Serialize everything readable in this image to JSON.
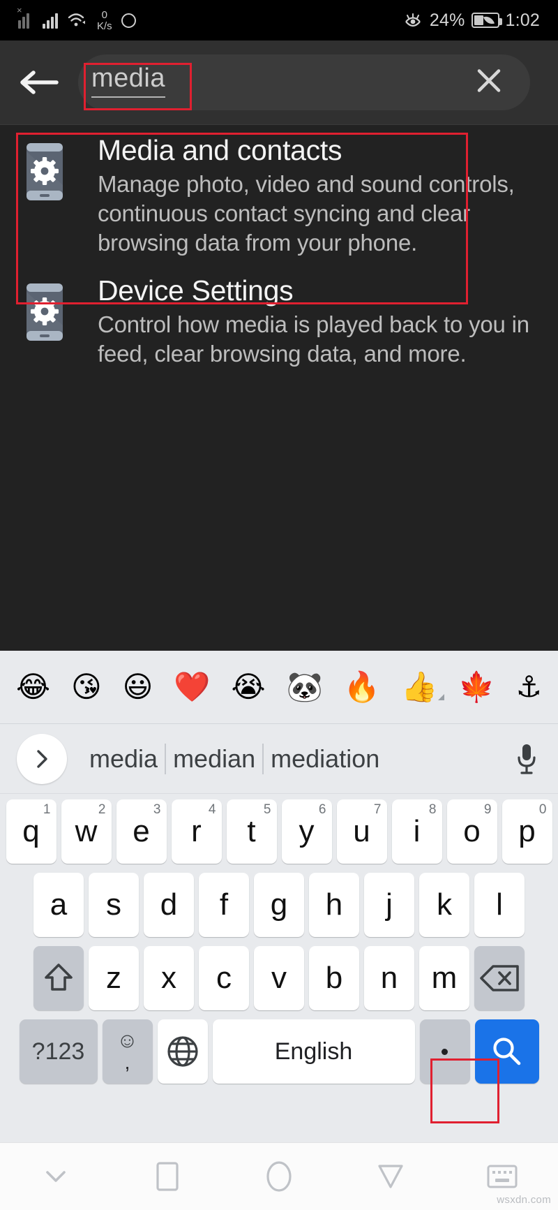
{
  "status_bar": {
    "network_speed_value": "0",
    "network_speed_unit": "K/s",
    "battery_percent": "24%",
    "clock": "1:02"
  },
  "search_header": {
    "query": "media",
    "back_label": "Back",
    "clear_label": "Clear"
  },
  "results": [
    {
      "title": "Media and contacts",
      "description": "Manage photo, video and sound controls, continuous contact syncing and clear browsing data from your phone."
    },
    {
      "title": "Device Settings",
      "description": "Control how media is played back to you in feed, clear browsing data, and more."
    }
  ],
  "keyboard": {
    "emojis": [
      "😂",
      "😘",
      "😃",
      "❤️",
      "😭",
      "🐼",
      "🔥",
      "👍",
      "🍁",
      "⚓"
    ],
    "emoji_names": [
      "joy",
      "kissing-heart",
      "smiley",
      "red-heart",
      "sob",
      "panda",
      "fire",
      "thumbs-up",
      "maple-leaf",
      "anchor"
    ],
    "suggestions": [
      "media",
      "median",
      "mediation"
    ],
    "row1": [
      {
        "key": "q",
        "num": "1"
      },
      {
        "key": "w",
        "num": "2"
      },
      {
        "key": "e",
        "num": "3"
      },
      {
        "key": "r",
        "num": "4"
      },
      {
        "key": "t",
        "num": "5"
      },
      {
        "key": "y",
        "num": "6"
      },
      {
        "key": "u",
        "num": "7"
      },
      {
        "key": "i",
        "num": "8"
      },
      {
        "key": "o",
        "num": "9"
      },
      {
        "key": "p",
        "num": "0"
      }
    ],
    "row2": [
      "a",
      "s",
      "d",
      "f",
      "g",
      "h",
      "j",
      "k",
      "l"
    ],
    "row3": [
      "z",
      "x",
      "c",
      "v",
      "b",
      "n",
      "m"
    ],
    "shift_label": "Shift",
    "backspace_label": "Backspace",
    "symbols_label": "?123",
    "emoji_key_label": ",",
    "language_label": "Language",
    "space_label": "English",
    "period_label": ".",
    "enter_label": "Search"
  },
  "nav_bar": {
    "hide_keyboard": "Hide keyboard",
    "recents": "Recents",
    "home": "Home",
    "back": "Back",
    "keyboard_switch": "Switch keyboard"
  },
  "watermark": "wsxdn.com",
  "colors": {
    "accent_blue": "#1a73e8",
    "highlight_red": "#e02030",
    "dark_bg": "#222222",
    "header_bg": "#303030",
    "keyboard_bg": "#e8eaed"
  }
}
